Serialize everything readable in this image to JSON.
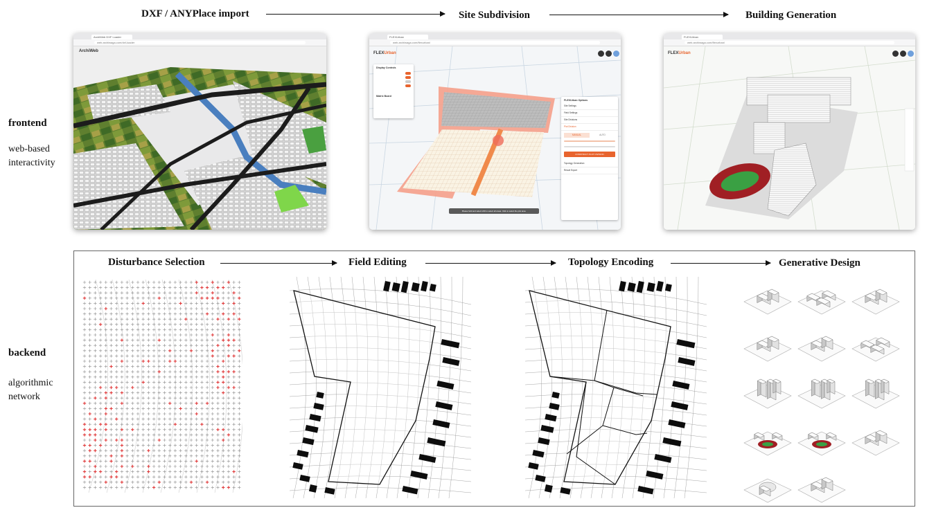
{
  "pipeline_top": {
    "stage1": "DXF / ANYPlace import",
    "stage2": "Site Subdivision",
    "stage3": "Building Generation"
  },
  "pipeline_bottom": {
    "stage1": "Disturbance Selection",
    "stage2": "Field Editing",
    "stage3": "Topology Encoding",
    "stage4": "Generative Design"
  },
  "sides": {
    "frontend_title": "frontend",
    "frontend_sub1": "web-based",
    "frontend_sub2": "interactivity",
    "backend_title": "backend",
    "backend_sub1": "algorithmic",
    "backend_sub2": "network"
  },
  "screenshot1": {
    "tab": "ArchiWeb DXF Loader",
    "url": "web.archiwaga.com/dxf-loader",
    "logo": "ArchiWeb"
  },
  "screenshot2": {
    "tab": "FLEXUrban",
    "url": "web.archiwaga.com/flexurban/",
    "logo_a": "FLEX",
    "logo_b": "Urban",
    "display_controls": "Display Controls",
    "matrix_board": "Matrix Board",
    "panel_title": "FLEXUrban Options",
    "rows": [
      "Site Settings",
      "Field Settings",
      "Site Divisions",
      "Plot Division"
    ],
    "mode_a": "MANUAL",
    "mode_b": "AUTO",
    "btn": "CONSTRUCT PLOT DIVISION",
    "row_after": [
      "Topology Generation",
      "Result Export"
    ],
    "hint": "Please hold and select shift to select all areas. Click to select the plot area."
  },
  "screenshot3": {
    "tab": "FLEXUrban",
    "url": "web.archiwaga.com/flexurban/",
    "logo_a": "FLEX",
    "logo_b": "Urban"
  },
  "colors": {
    "accent_orange": "#e8642e",
    "water_blue": "#4a7fbf",
    "field_green": "#3f7a2e",
    "track_red": "#a01f24",
    "disturbance_red": "#e0393a"
  }
}
